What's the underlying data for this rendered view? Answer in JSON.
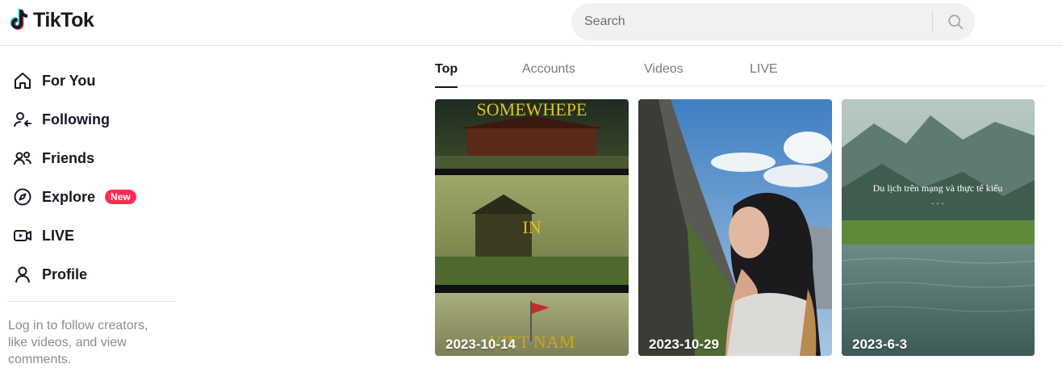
{
  "header": {
    "logo_text": "TikTok",
    "search_placeholder": "Search"
  },
  "sidebar": {
    "items": [
      {
        "label": "For You",
        "icon": "home-icon"
      },
      {
        "label": "Following",
        "icon": "following-icon"
      },
      {
        "label": "Friends",
        "icon": "friends-icon"
      },
      {
        "label": "Explore",
        "icon": "compass-icon",
        "badge": "New"
      },
      {
        "label": "LIVE",
        "icon": "live-icon"
      },
      {
        "label": "Profile",
        "icon": "profile-icon"
      }
    ],
    "login_hint": "Log in to follow creators, like videos, and view comments."
  },
  "tabs": [
    {
      "label": "Top",
      "active": true
    },
    {
      "label": "Accounts",
      "active": false
    },
    {
      "label": "Videos",
      "active": false
    },
    {
      "label": "LIVE",
      "active": false
    }
  ],
  "videos": [
    {
      "date": "2023-10-14",
      "overlay_texts": [
        "SOMEWHEPE",
        "IN",
        "VIET NAM"
      ]
    },
    {
      "date": "2023-10-29"
    },
    {
      "date": "2023-6-3",
      "overlay_texts": [
        "Du lịch trên mạng và thực tế kiểu",
        ". . ."
      ]
    }
  ],
  "colors": {
    "brand": "#fe2c55",
    "text": "#161823",
    "muted": "#8a8b91"
  }
}
